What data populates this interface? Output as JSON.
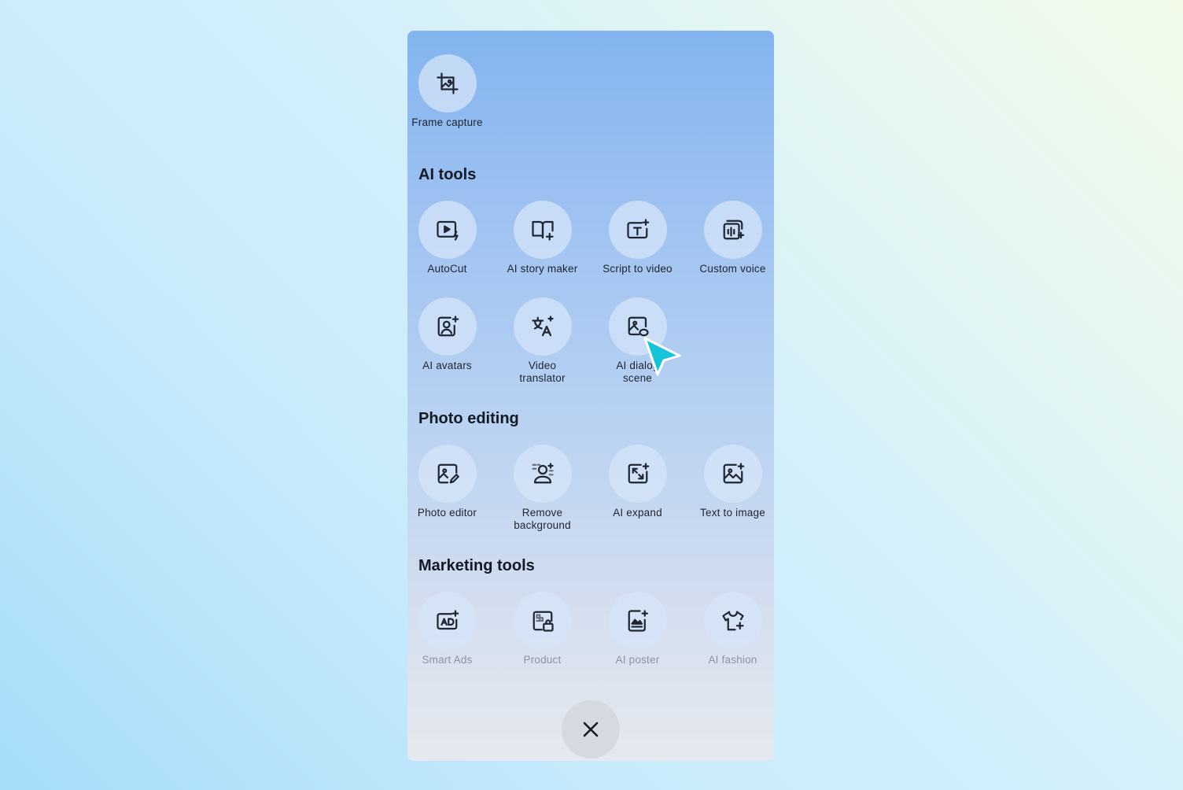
{
  "top_tools": [
    {
      "label": "Frame capture",
      "icon": "crop-icon"
    }
  ],
  "sections": {
    "ai_tools": {
      "title": "AI tools",
      "items": [
        {
          "label": "AutoCut",
          "icon": "video-bolt-icon"
        },
        {
          "label": "AI story maker",
          "icon": "book-sparkle-icon"
        },
        {
          "label": "Script to video",
          "icon": "text-sparkle-icon"
        },
        {
          "label": "Custom voice",
          "icon": "waveform-sparkle-icon"
        },
        {
          "label": "AI avatars",
          "icon": "avatar-sparkle-icon"
        },
        {
          "label": "Video\ntranslator",
          "icon": "translate-icon"
        },
        {
          "label": "AI dialog\nscene",
          "icon": "image-chat-icon"
        }
      ]
    },
    "photo_editing": {
      "title": "Photo editing",
      "items": [
        {
          "label": "Photo editor",
          "icon": "image-edit-icon"
        },
        {
          "label": "Remove\nbackground",
          "icon": "person-cutout-icon"
        },
        {
          "label": "AI expand",
          "icon": "image-expand-icon"
        },
        {
          "label": "Text to image",
          "icon": "image-sparkle-icon"
        }
      ]
    },
    "marketing_tools": {
      "title": "Marketing tools",
      "items": [
        {
          "label": "Smart Ads",
          "icon": "ad-sparkle-icon"
        },
        {
          "label": "Product",
          "icon": "product-bag-icon"
        },
        {
          "label": "AI poster",
          "icon": "poster-sparkle-icon"
        },
        {
          "label": "AI fashion",
          "icon": "shirt-sparkle-icon"
        }
      ]
    }
  },
  "close_button": {
    "icon": "close-icon"
  },
  "colors": {
    "cursor": "#15c4d8",
    "icon_stroke": "#1f2733"
  }
}
